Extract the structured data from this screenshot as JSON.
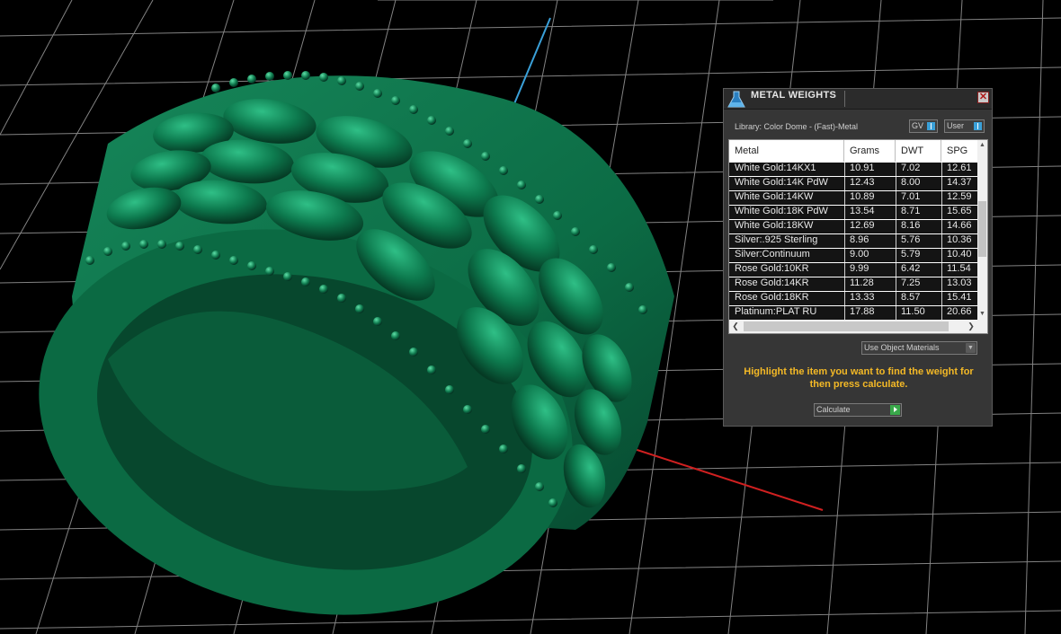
{
  "panel": {
    "title": "METAL WEIGHTS",
    "close_icon": "close-icon",
    "library_label": "Library: Color Dome - (Fast)-Metal",
    "gv_toggle_label": "GV",
    "user_toggle_label": "User",
    "columns": [
      "Metal",
      "Grams",
      "DWT",
      "SPG"
    ],
    "rows": [
      {
        "metal": "White Gold:14KX1",
        "grams": "10.91",
        "dwt": "7.02",
        "spg": "12.61"
      },
      {
        "metal": "White Gold:14K PdW",
        "grams": "12.43",
        "dwt": "8.00",
        "spg": "14.37"
      },
      {
        "metal": "White Gold:14KW",
        "grams": "10.89",
        "dwt": "7.01",
        "spg": "12.59"
      },
      {
        "metal": "White Gold:18K PdW",
        "grams": "13.54",
        "dwt": "8.71",
        "spg": "15.65"
      },
      {
        "metal": "White Gold:18KW",
        "grams": "12.69",
        "dwt": "8.16",
        "spg": "14.66"
      },
      {
        "metal": "Silver:.925 Sterling",
        "grams": "8.96",
        "dwt": "5.76",
        "spg": "10.36"
      },
      {
        "metal": "Silver:Continuum",
        "grams": "9.00",
        "dwt": "5.79",
        "spg": "10.40"
      },
      {
        "metal": "Rose Gold:10KR",
        "grams": "9.99",
        "dwt": "6.42",
        "spg": "11.54"
      },
      {
        "metal": "Rose Gold:14KR",
        "grams": "11.28",
        "dwt": "7.25",
        "spg": "13.03"
      },
      {
        "metal": "Rose Gold:18KR",
        "grams": "13.33",
        "dwt": "8.57",
        "spg": "15.41"
      },
      {
        "metal": "Platinum:PLAT RU",
        "grams": "17.88",
        "dwt": "11.50",
        "spg": "20.66"
      }
    ],
    "materials_select_value": "Use Object Materials",
    "hint_text": "Highlight the item you want to find the weight for then press calculate.",
    "calculate_label": "Calculate"
  },
  "colors": {
    "ring_green": "#0f7a4e",
    "hint_yellow": "#f4b926",
    "axis_blue": "#3aa0d8",
    "axis_red": "#d02020"
  }
}
